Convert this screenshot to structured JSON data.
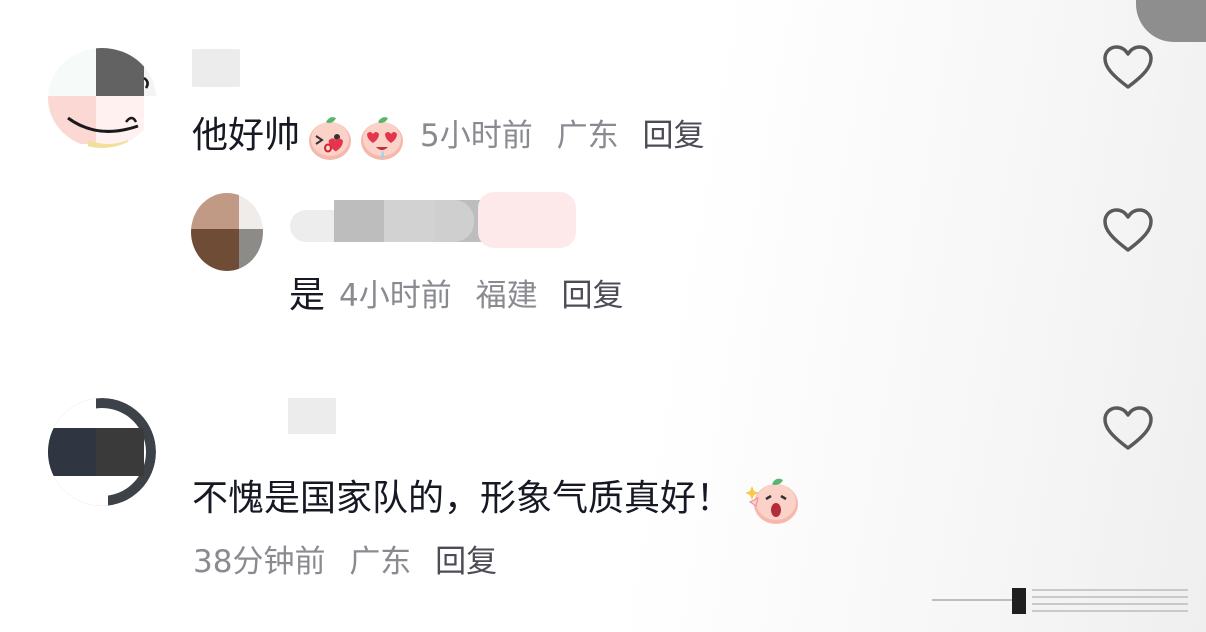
{
  "comments": [
    {
      "text": "他好帅",
      "emojis": [
        "kiss-emoji",
        "heart-eyes-emoji"
      ],
      "time": "5小时前",
      "location": "广东",
      "reply_label": "回复"
    },
    {
      "text": "是",
      "time": "4小时前",
      "location": "福建",
      "reply_label": "回复"
    },
    {
      "text": "不愧是国家队的，形象气质真好！",
      "emojis": [
        "surprised-emoji"
      ],
      "time": "38分钟前",
      "location": "广东",
      "reply_label": "回复"
    }
  ],
  "colors": {
    "text": "#161823",
    "meta": "#8a8b91",
    "heart_outline": "#5a5a5a"
  },
  "icons": [
    "heart-outline-icon"
  ]
}
